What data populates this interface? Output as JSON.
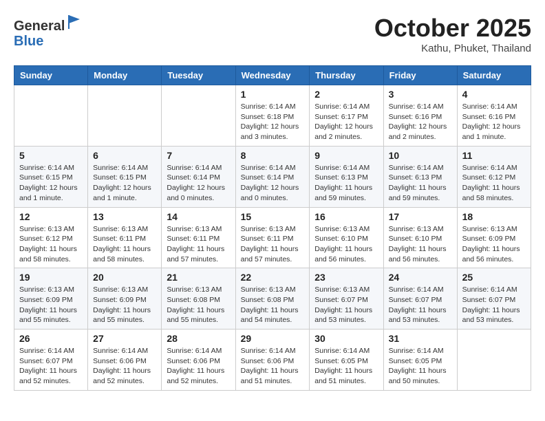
{
  "header": {
    "logo_line1": "General",
    "logo_line2": "Blue",
    "month_title": "October 2025",
    "location": "Kathu, Phuket, Thailand"
  },
  "days_of_week": [
    "Sunday",
    "Monday",
    "Tuesday",
    "Wednesday",
    "Thursday",
    "Friday",
    "Saturday"
  ],
  "weeks": [
    [
      {
        "day": "",
        "info": ""
      },
      {
        "day": "",
        "info": ""
      },
      {
        "day": "",
        "info": ""
      },
      {
        "day": "1",
        "info": "Sunrise: 6:14 AM\nSunset: 6:18 PM\nDaylight: 12 hours and 3 minutes."
      },
      {
        "day": "2",
        "info": "Sunrise: 6:14 AM\nSunset: 6:17 PM\nDaylight: 12 hours and 2 minutes."
      },
      {
        "day": "3",
        "info": "Sunrise: 6:14 AM\nSunset: 6:16 PM\nDaylight: 12 hours and 2 minutes."
      },
      {
        "day": "4",
        "info": "Sunrise: 6:14 AM\nSunset: 6:16 PM\nDaylight: 12 hours and 1 minute."
      }
    ],
    [
      {
        "day": "5",
        "info": "Sunrise: 6:14 AM\nSunset: 6:15 PM\nDaylight: 12 hours and 1 minute."
      },
      {
        "day": "6",
        "info": "Sunrise: 6:14 AM\nSunset: 6:15 PM\nDaylight: 12 hours and 1 minute."
      },
      {
        "day": "7",
        "info": "Sunrise: 6:14 AM\nSunset: 6:14 PM\nDaylight: 12 hours and 0 minutes."
      },
      {
        "day": "8",
        "info": "Sunrise: 6:14 AM\nSunset: 6:14 PM\nDaylight: 12 hours and 0 minutes."
      },
      {
        "day": "9",
        "info": "Sunrise: 6:14 AM\nSunset: 6:13 PM\nDaylight: 11 hours and 59 minutes."
      },
      {
        "day": "10",
        "info": "Sunrise: 6:14 AM\nSunset: 6:13 PM\nDaylight: 11 hours and 59 minutes."
      },
      {
        "day": "11",
        "info": "Sunrise: 6:14 AM\nSunset: 6:12 PM\nDaylight: 11 hours and 58 minutes."
      }
    ],
    [
      {
        "day": "12",
        "info": "Sunrise: 6:13 AM\nSunset: 6:12 PM\nDaylight: 11 hours and 58 minutes."
      },
      {
        "day": "13",
        "info": "Sunrise: 6:13 AM\nSunset: 6:11 PM\nDaylight: 11 hours and 58 minutes."
      },
      {
        "day": "14",
        "info": "Sunrise: 6:13 AM\nSunset: 6:11 PM\nDaylight: 11 hours and 57 minutes."
      },
      {
        "day": "15",
        "info": "Sunrise: 6:13 AM\nSunset: 6:11 PM\nDaylight: 11 hours and 57 minutes."
      },
      {
        "day": "16",
        "info": "Sunrise: 6:13 AM\nSunset: 6:10 PM\nDaylight: 11 hours and 56 minutes."
      },
      {
        "day": "17",
        "info": "Sunrise: 6:13 AM\nSunset: 6:10 PM\nDaylight: 11 hours and 56 minutes."
      },
      {
        "day": "18",
        "info": "Sunrise: 6:13 AM\nSunset: 6:09 PM\nDaylight: 11 hours and 56 minutes."
      }
    ],
    [
      {
        "day": "19",
        "info": "Sunrise: 6:13 AM\nSunset: 6:09 PM\nDaylight: 11 hours and 55 minutes."
      },
      {
        "day": "20",
        "info": "Sunrise: 6:13 AM\nSunset: 6:09 PM\nDaylight: 11 hours and 55 minutes."
      },
      {
        "day": "21",
        "info": "Sunrise: 6:13 AM\nSunset: 6:08 PM\nDaylight: 11 hours and 55 minutes."
      },
      {
        "day": "22",
        "info": "Sunrise: 6:13 AM\nSunset: 6:08 PM\nDaylight: 11 hours and 54 minutes."
      },
      {
        "day": "23",
        "info": "Sunrise: 6:13 AM\nSunset: 6:07 PM\nDaylight: 11 hours and 53 minutes."
      },
      {
        "day": "24",
        "info": "Sunrise: 6:14 AM\nSunset: 6:07 PM\nDaylight: 11 hours and 53 minutes."
      },
      {
        "day": "25",
        "info": "Sunrise: 6:14 AM\nSunset: 6:07 PM\nDaylight: 11 hours and 53 minutes."
      }
    ],
    [
      {
        "day": "26",
        "info": "Sunrise: 6:14 AM\nSunset: 6:07 PM\nDaylight: 11 hours and 52 minutes."
      },
      {
        "day": "27",
        "info": "Sunrise: 6:14 AM\nSunset: 6:06 PM\nDaylight: 11 hours and 52 minutes."
      },
      {
        "day": "28",
        "info": "Sunrise: 6:14 AM\nSunset: 6:06 PM\nDaylight: 11 hours and 52 minutes."
      },
      {
        "day": "29",
        "info": "Sunrise: 6:14 AM\nSunset: 6:06 PM\nDaylight: 11 hours and 51 minutes."
      },
      {
        "day": "30",
        "info": "Sunrise: 6:14 AM\nSunset: 6:05 PM\nDaylight: 11 hours and 51 minutes."
      },
      {
        "day": "31",
        "info": "Sunrise: 6:14 AM\nSunset: 6:05 PM\nDaylight: 11 hours and 50 minutes."
      },
      {
        "day": "",
        "info": ""
      }
    ]
  ]
}
